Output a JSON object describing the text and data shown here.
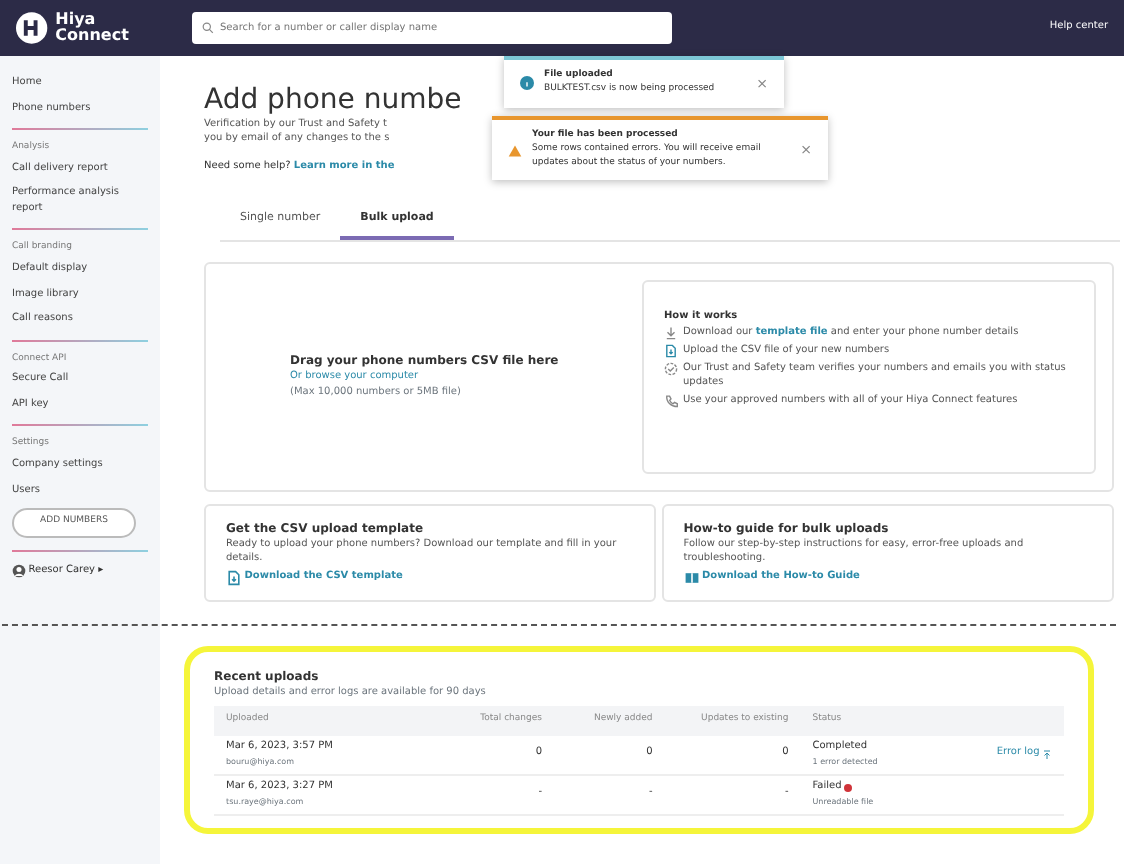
{
  "topbar": {
    "logo": "Hiya Connect",
    "search_placeholder": "Search for a number or caller display name",
    "help": "Help center"
  },
  "sidebar": {
    "groups": [
      {
        "items": [
          "Home",
          "Phone numbers"
        ]
      },
      {
        "title": "Analysis",
        "items": [
          "Call delivery report",
          "Performance analysis report"
        ]
      },
      {
        "title": "Call branding",
        "items": [
          "Default display",
          "Image library",
          "Call reasons"
        ]
      },
      {
        "title": "Connect API",
        "items": [
          "Secure Call",
          "API key"
        ]
      },
      {
        "title": "Settings",
        "items": [
          "Company settings",
          "Users"
        ]
      }
    ],
    "add_button": "ADD NUMBERS",
    "user": "Reesor Carey ▸"
  },
  "page": {
    "title": "Add phone numbe",
    "intro_lines": [
      "Verification by our Trust and Safety t",
      "you by email of any changes to the s"
    ],
    "help_text": "Need some help? ",
    "help_link": "Learn more in the"
  },
  "toasts": [
    {
      "kind": "info",
      "title": "File uploaded",
      "message": "BULKTEST.csv is now being processed",
      "close": "×"
    },
    {
      "kind": "warning",
      "title": "Your file has been processed",
      "message": "Some rows contained errors. You will receive email updates about the status of your numbers.",
      "close": "×"
    }
  ],
  "tabs": [
    {
      "label": "Single number",
      "selected": false
    },
    {
      "label": "Bulk upload",
      "selected": true
    }
  ],
  "dropzone": {
    "title": "Drag your phone numbers CSV file here",
    "link": "Or browse your computer",
    "note": "(Max 10,000 numbers or 5MB file)"
  },
  "how_it_works": {
    "title": "How it works",
    "steps": [
      {
        "kind": "download",
        "parts": [
          {
            "text": "Download our "
          },
          {
            "link": "template file"
          },
          {
            "text": " and enter your phone number details"
          }
        ]
      },
      {
        "kind": "file",
        "parts": [
          {
            "text": "Upload the CSV file of your new numbers"
          }
        ]
      },
      {
        "kind": "verify",
        "parts": [
          {
            "text": "Our Trust and Safety team verifies your numbers and emails you with status updates"
          }
        ]
      },
      {
        "kind": "phone",
        "parts": [
          {
            "text": "Use your approved numbers with all of your Hiya Connect features"
          }
        ]
      }
    ]
  },
  "cards": [
    {
      "kind": "file",
      "title": "Get the CSV upload template",
      "text": "Ready to upload your phone numbers? Download our template and fill in your details.",
      "link": "Download the CSV template"
    },
    {
      "kind": "book",
      "title": "How-to guide for bulk uploads",
      "text": "Follow our step-by-step instructions for easy, error-free uploads and troubleshooting.",
      "link": "Download the How-to Guide"
    }
  ],
  "recent_uploads": {
    "title": "Recent uploads",
    "subtitle": "Upload details and error logs are available for 90 days",
    "columns": [
      "Uploaded",
      "Total changes",
      "Newly added",
      "Updates to existing",
      "Status"
    ],
    "rows": [
      {
        "date": "Mar 6, 2023, 3:57 PM",
        "user": "bouru@hiya.com",
        "total": "0",
        "added": "0",
        "updated": "0",
        "status": "Completed",
        "error": false,
        "detail": "1 error detected",
        "action": "Error log"
      },
      {
        "date": "Mar 6, 2023, 3:27 PM",
        "user": "tsu.raye@hiya.com",
        "total": "-",
        "added": "-",
        "updated": "-",
        "status": "Failed",
        "error": true,
        "detail": "Unreadable file"
      }
    ]
  }
}
